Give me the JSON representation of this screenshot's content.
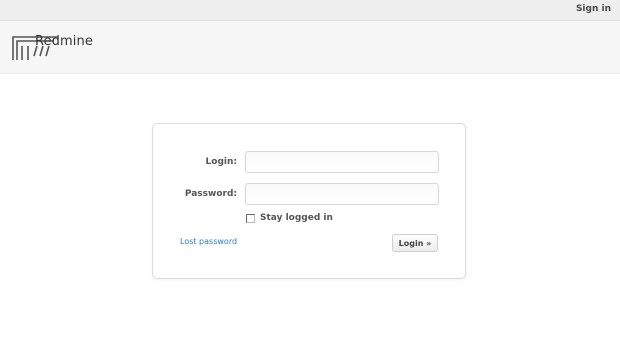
{
  "topbar": {
    "signin_label": "Sign in"
  },
  "header": {
    "app_title": "Redmine",
    "logo_icon": "redmine-logo-icon"
  },
  "login_form": {
    "login_label": "Login:",
    "login_value": "",
    "password_label": "Password:",
    "password_value": "",
    "stay_logged_in_label": "Stay logged in",
    "stay_logged_in_checked": false,
    "lost_password_label": "Lost password",
    "submit_label": "Login »"
  },
  "colors": {
    "link": "#2a7ec7",
    "topbar_bg": "#eeeeee",
    "header_bg": "#f6f6f6"
  }
}
